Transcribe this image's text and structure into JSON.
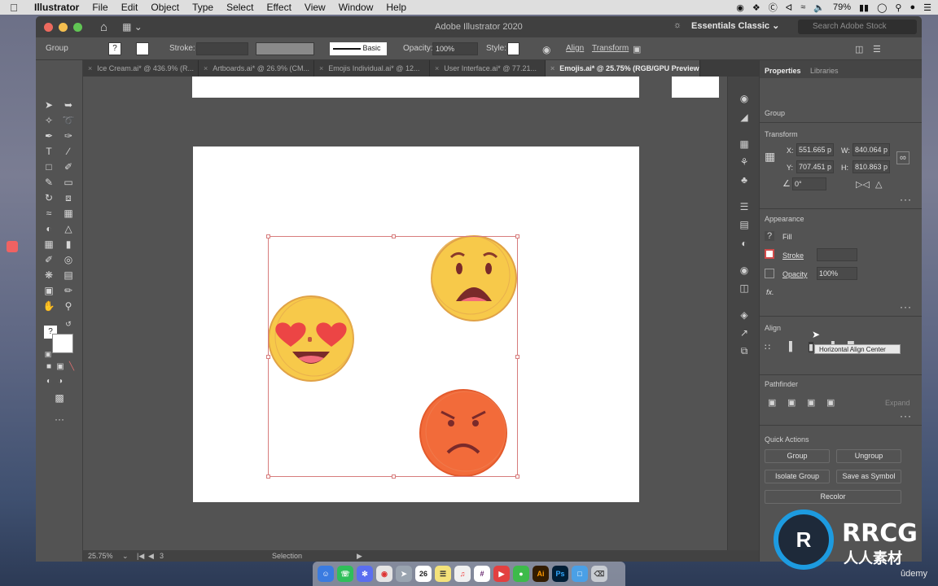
{
  "menubar": {
    "app": "Illustrator",
    "items": [
      "File",
      "Edit",
      "Object",
      "Type",
      "Select",
      "Effect",
      "View",
      "Window",
      "Help"
    ],
    "battery": "79%"
  },
  "window": {
    "title": "Adobe Illustrator 2020",
    "workspace": "Essentials Classic",
    "search_placeholder": "Search Adobe Stock"
  },
  "control": {
    "selection_label": "Group",
    "stroke_label": "Stroke:",
    "brush_label": "Basic",
    "opacity_label": "Opacity:",
    "opacity_value": "100%",
    "style_label": "Style:",
    "align_label": "Align",
    "transform_label": "Transform"
  },
  "tabs": [
    {
      "label": "Ice Cream.ai* @ 436.9% (R..."
    },
    {
      "label": "Artboards.ai* @ 26.9% (CM..."
    },
    {
      "label": "Emojis Individual.ai* @ 12..."
    },
    {
      "label": "User Interface.ai* @ 77.21..."
    },
    {
      "label": "Emojis.ai* @ 25.75% (RGB/GPU Preview)"
    }
  ],
  "status": {
    "zoom": "25.75%",
    "artboard": "3",
    "tool": "Selection"
  },
  "panel": {
    "tab_properties": "Properties",
    "tab_libraries": "Libraries",
    "selection_type": "Group",
    "transform_heading": "Transform",
    "x_label": "X:",
    "x_value": "551.665 p",
    "y_label": "Y:",
    "y_value": "707.451 p",
    "w_label": "W:",
    "w_value": "840.064 p",
    "h_label": "H:",
    "h_value": "810.863 p",
    "angle_value": "0°",
    "appearance_heading": "Appearance",
    "fill_label": "Fill",
    "stroke_label": "Stroke",
    "opacity_label": "Opacity",
    "opacity_value": "100%",
    "fx_label": "fx.",
    "align_heading": "Align",
    "tooltip": "Horizontal Align Center",
    "pathfinder_heading": "Pathfinder",
    "expand_label": "Expand",
    "quick_actions_heading": "Quick Actions",
    "btn_group": "Group",
    "btn_ungroup": "Ungroup",
    "btn_isolate": "Isolate Group",
    "btn_symbol": "Save as Symbol",
    "btn_recolor": "Recolor"
  },
  "dock": {
    "calendar_day": "26"
  },
  "watermark": {
    "logo_text": "RRCG",
    "sub_text": "人人素材",
    "udemy": "ûdemy"
  },
  "colors": {
    "accent_red": "#d77c7c",
    "emoji_yellow": "#f7c94a",
    "emoji_orange": "#f26b3a"
  }
}
